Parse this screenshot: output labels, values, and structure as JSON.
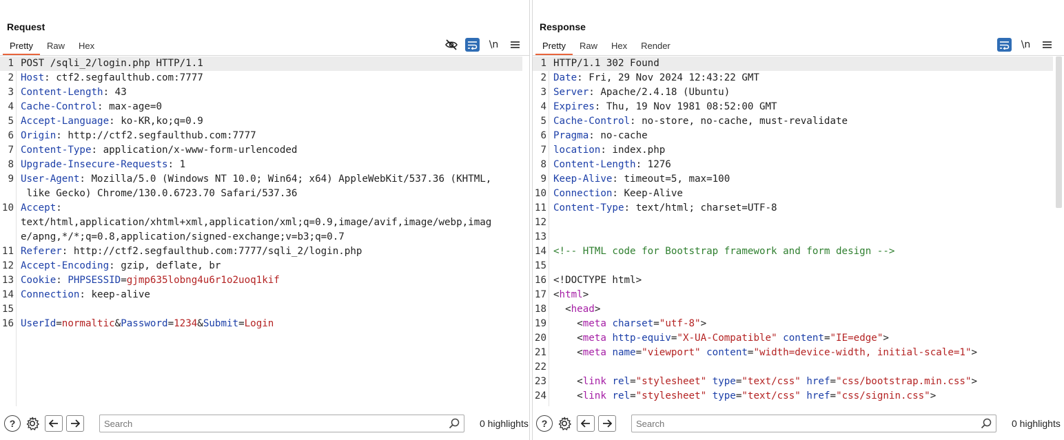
{
  "request": {
    "title": "Request",
    "tabs": [
      "Pretty",
      "Raw",
      "Hex"
    ],
    "active_tab": "Pretty",
    "lines": [
      {
        "n": "1",
        "parts": [
          [
            "v",
            "POST /sqli_2/login.php HTTP/1.1"
          ]
        ]
      },
      {
        "n": "2",
        "parts": [
          [
            "k",
            "Host"
          ],
          [
            "v",
            ": ctf2.segfaulthub.com:7777"
          ]
        ]
      },
      {
        "n": "3",
        "parts": [
          [
            "k",
            "Content-Length"
          ],
          [
            "v",
            ": 43"
          ]
        ]
      },
      {
        "n": "4",
        "parts": [
          [
            "k",
            "Cache-Control"
          ],
          [
            "v",
            ": max-age=0"
          ]
        ]
      },
      {
        "n": "5",
        "parts": [
          [
            "k",
            "Accept-Language"
          ],
          [
            "v",
            ": ko-KR,ko;q=0.9"
          ]
        ]
      },
      {
        "n": "6",
        "parts": [
          [
            "k",
            "Origin"
          ],
          [
            "v",
            ": http://ctf2.segfaulthub.com:7777"
          ]
        ]
      },
      {
        "n": "7",
        "parts": [
          [
            "k",
            "Content-Type"
          ],
          [
            "v",
            ": application/x-www-form-urlencoded"
          ]
        ]
      },
      {
        "n": "8",
        "parts": [
          [
            "k",
            "Upgrade-Insecure-Requests"
          ],
          [
            "v",
            ": 1"
          ]
        ]
      },
      {
        "n": "9",
        "parts": [
          [
            "k",
            "User-Agent"
          ],
          [
            "v",
            ": Mozilla/5.0 (Windows NT 10.0; Win64; x64) AppleWebKit/537.36 (KHTML,"
          ]
        ]
      },
      {
        "n": "",
        "parts": [
          [
            "v",
            " like Gecko) Chrome/130.0.6723.70 Safari/537.36"
          ]
        ]
      },
      {
        "n": "10",
        "parts": [
          [
            "k",
            "Accept"
          ],
          [
            "v",
            ":"
          ]
        ]
      },
      {
        "n": "",
        "parts": [
          [
            "v",
            "text/html,application/xhtml+xml,application/xml;q=0.9,image/avif,image/webp,imag"
          ]
        ]
      },
      {
        "n": "",
        "parts": [
          [
            "v",
            "e/apng,*/*;q=0.8,application/signed-exchange;v=b3;q=0.7"
          ]
        ]
      },
      {
        "n": "11",
        "parts": [
          [
            "k",
            "Referer"
          ],
          [
            "v",
            ": http://ctf2.segfaulthub.com:7777/sqli_2/login.php"
          ]
        ]
      },
      {
        "n": "12",
        "parts": [
          [
            "k",
            "Accept-Encoding"
          ],
          [
            "v",
            ": gzip, deflate, br"
          ]
        ]
      },
      {
        "n": "13",
        "parts": [
          [
            "k",
            "Cookie"
          ],
          [
            "v",
            ": "
          ],
          [
            "k",
            "PHPSESSID"
          ],
          [
            "v",
            "="
          ],
          [
            "c",
            "gjmp635lobng4u6r1o2uoq1kif"
          ]
        ]
      },
      {
        "n": "14",
        "parts": [
          [
            "k",
            "Connection"
          ],
          [
            "v",
            ": keep-alive"
          ]
        ]
      },
      {
        "n": "15",
        "parts": []
      },
      {
        "n": "16",
        "parts": [
          [
            "k",
            "UserId"
          ],
          [
            "v",
            "="
          ],
          [
            "c",
            "normaltic"
          ],
          [
            "v",
            "&"
          ],
          [
            "k",
            "Password"
          ],
          [
            "v",
            "="
          ],
          [
            "c",
            "1234"
          ],
          [
            "v",
            "&"
          ],
          [
            "k",
            "Submit"
          ],
          [
            "v",
            "="
          ],
          [
            "c",
            "Login"
          ]
        ]
      }
    ],
    "footer": {
      "search_placeholder": "Search",
      "highlights": "0 highlights"
    }
  },
  "response": {
    "title": "Response",
    "tabs": [
      "Pretty",
      "Raw",
      "Hex",
      "Render"
    ],
    "active_tab": "Pretty",
    "lines": [
      {
        "n": "1",
        "parts": [
          [
            "v",
            "HTTP/1.1 302 Found"
          ]
        ]
      },
      {
        "n": "2",
        "parts": [
          [
            "k",
            "Date"
          ],
          [
            "v",
            ": Fri, 29 Nov 2024 12:43:22 GMT"
          ]
        ]
      },
      {
        "n": "3",
        "parts": [
          [
            "k",
            "Server"
          ],
          [
            "v",
            ": Apache/2.4.18 (Ubuntu)"
          ]
        ]
      },
      {
        "n": "4",
        "parts": [
          [
            "k",
            "Expires"
          ],
          [
            "v",
            ": Thu, 19 Nov 1981 08:52:00 GMT"
          ]
        ]
      },
      {
        "n": "5",
        "parts": [
          [
            "k",
            "Cache-Control"
          ],
          [
            "v",
            ": no-store, no-cache, must-revalidate"
          ]
        ]
      },
      {
        "n": "6",
        "parts": [
          [
            "k",
            "Pragma"
          ],
          [
            "v",
            ": no-cache"
          ]
        ]
      },
      {
        "n": "7",
        "parts": [
          [
            "k",
            "location"
          ],
          [
            "v",
            ": index.php"
          ]
        ]
      },
      {
        "n": "8",
        "parts": [
          [
            "k",
            "Content-Length"
          ],
          [
            "v",
            ": 1276"
          ]
        ]
      },
      {
        "n": "9",
        "parts": [
          [
            "k",
            "Keep-Alive"
          ],
          [
            "v",
            ": timeout=5, max=100"
          ]
        ]
      },
      {
        "n": "10",
        "parts": [
          [
            "k",
            "Connection"
          ],
          [
            "v",
            ": Keep-Alive"
          ]
        ]
      },
      {
        "n": "11",
        "parts": [
          [
            "k",
            "Content-Type"
          ],
          [
            "v",
            ": text/html; charset=UTF-8"
          ]
        ]
      },
      {
        "n": "12",
        "parts": []
      },
      {
        "n": "13",
        "parts": []
      },
      {
        "n": "14",
        "parts": [
          [
            "cm",
            "<!-- HTML code for Bootstrap framework and form design -->"
          ]
        ]
      },
      {
        "n": "15",
        "parts": []
      },
      {
        "n": "16",
        "parts": [
          [
            "v",
            "<!DOCTYPE html>"
          ]
        ]
      },
      {
        "n": "17",
        "parts": [
          [
            "v",
            "<"
          ],
          [
            "tg",
            "html"
          ],
          [
            "v",
            ">"
          ]
        ]
      },
      {
        "n": "18",
        "parts": [
          [
            "v",
            "  <"
          ],
          [
            "tg",
            "head"
          ],
          [
            "v",
            ">"
          ]
        ]
      },
      {
        "n": "19",
        "parts": [
          [
            "v",
            "    <"
          ],
          [
            "tg",
            "meta"
          ],
          [
            "v",
            " "
          ],
          [
            "at",
            "charset"
          ],
          [
            "v",
            "="
          ],
          [
            "sv",
            "\"utf-8\""
          ],
          [
            "v",
            ">"
          ]
        ]
      },
      {
        "n": "20",
        "parts": [
          [
            "v",
            "    <"
          ],
          [
            "tg",
            "meta"
          ],
          [
            "v",
            " "
          ],
          [
            "at",
            "http-equiv"
          ],
          [
            "v",
            "="
          ],
          [
            "sv",
            "\"X-UA-Compatible\""
          ],
          [
            "v",
            " "
          ],
          [
            "at",
            "content"
          ],
          [
            "v",
            "="
          ],
          [
            "sv",
            "\"IE=edge\""
          ],
          [
            "v",
            ">"
          ]
        ]
      },
      {
        "n": "21",
        "parts": [
          [
            "v",
            "    <"
          ],
          [
            "tg",
            "meta"
          ],
          [
            "v",
            " "
          ],
          [
            "at",
            "name"
          ],
          [
            "v",
            "="
          ],
          [
            "sv",
            "\"viewport\""
          ],
          [
            "v",
            " "
          ],
          [
            "at",
            "content"
          ],
          [
            "v",
            "="
          ],
          [
            "sv",
            "\"width=device-width, initial-scale=1\""
          ],
          [
            "v",
            ">"
          ]
        ]
      },
      {
        "n": "22",
        "parts": []
      },
      {
        "n": "23",
        "parts": [
          [
            "v",
            "    <"
          ],
          [
            "tg",
            "link"
          ],
          [
            "v",
            " "
          ],
          [
            "at",
            "rel"
          ],
          [
            "v",
            "="
          ],
          [
            "sv",
            "\"stylesheet\""
          ],
          [
            "v",
            " "
          ],
          [
            "at",
            "type"
          ],
          [
            "v",
            "="
          ],
          [
            "sv",
            "\"text/css\""
          ],
          [
            "v",
            " "
          ],
          [
            "at",
            "href"
          ],
          [
            "v",
            "="
          ],
          [
            "sv",
            "\"css/bootstrap.min.css\""
          ],
          [
            "v",
            ">"
          ]
        ]
      },
      {
        "n": "24",
        "parts": [
          [
            "v",
            "    <"
          ],
          [
            "tg",
            "link"
          ],
          [
            "v",
            " "
          ],
          [
            "at",
            "rel"
          ],
          [
            "v",
            "="
          ],
          [
            "sv",
            "\"stylesheet\""
          ],
          [
            "v",
            " "
          ],
          [
            "at",
            "type"
          ],
          [
            "v",
            "="
          ],
          [
            "sv",
            "\"text/css\""
          ],
          [
            "v",
            " "
          ],
          [
            "at",
            "href"
          ],
          [
            "v",
            "="
          ],
          [
            "sv",
            "\"css/signin.css\""
          ],
          [
            "v",
            ">"
          ]
        ]
      }
    ],
    "footer": {
      "search_placeholder": "Search",
      "highlights": "0 highlights"
    }
  },
  "icons": {
    "hide": "eye-slash-icon",
    "wrap": "word-wrap-icon",
    "newline": "\\n",
    "menu": "hamburger-menu-icon",
    "help": "?",
    "settings": "gear-icon",
    "back": "arrow-left-icon",
    "forward": "arrow-right-icon",
    "search": "magnifier-icon"
  },
  "colors": {
    "accent_tab": "#e8643b",
    "active_button": "#2f6db5"
  }
}
